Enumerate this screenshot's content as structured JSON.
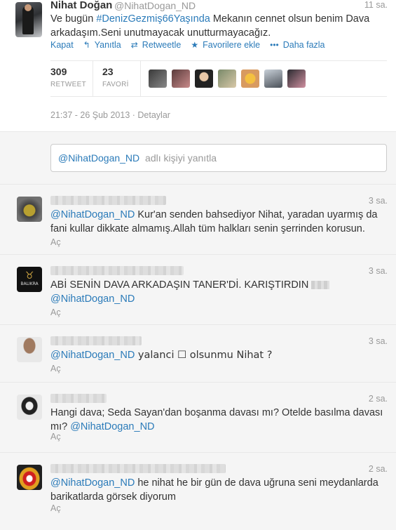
{
  "main_tweet": {
    "name": "Nihat Doğan",
    "handle": "@NihatDogan_ND",
    "time": "11 sa.",
    "text_1": "Ve bugün ",
    "hashtag": "#DenizGezmiş66Yaşında",
    "text_2": " Mekanın cennet olsun benim Dava arkadaşım.Seni unutmayacak unutturmayacağız.",
    "actions": [
      {
        "label": "Kapat",
        "icon": "none"
      },
      {
        "label": "Yanıtla",
        "icon": "reply-arrow-icon"
      },
      {
        "label": "Retweetle",
        "icon": "retweet-icon"
      },
      {
        "label": "Favorilere ekle",
        "icon": "star-icon"
      },
      {
        "label": "Daha fazla",
        "icon": "more-dots-icon"
      }
    ],
    "stats": {
      "retweet_count": "309",
      "retweet_label": "RETWEET",
      "favorite_count": "23",
      "favorite_label": "FAVORİ"
    },
    "timestamp": "21:37 - 26 Şub 2013",
    "separator": " · ",
    "details": "Detaylar"
  },
  "reply_box": {
    "mention": "@NihatDogan_ND",
    "placeholder": "adlı kişiyi yanıtla"
  },
  "replies": [
    {
      "time": "3 sa.",
      "mention": "@NihatDogan_ND",
      "text": " Kur'an senden bahsediyor Nihat, yaradan uyarmış da fani kullar dikkate almamış.Allah tüm halkları senin şerrinden korusun.",
      "reply_label": "Aç"
    },
    {
      "time": "3 sa.",
      "text": "ABİ SENİN DAVA ARKADAŞIN TANER'Dİ. KARIŞTIRDIN ",
      "mention": "@NihatDogan_ND",
      "reply_label": "Aç",
      "avatar_label": "BALIKRA"
    },
    {
      "time": "3 sa.",
      "mention": "@NihatDogan_ND",
      "text": " yalanci ☐ olsunmu Nihat ?",
      "reply_label": "Aç"
    },
    {
      "time": "2 sa.",
      "text": "Hangi dava; Seda Sayan'dan boşanma davası mı? Otelde basılma davası mı? ",
      "mention": "@NihatDogan_ND",
      "reply_label": "Aç"
    },
    {
      "time": "2 sa.",
      "mention": "@NihatDogan_ND",
      "text": " he nihat he bir gün de dava uğruna seni meydanlarda barikatlarda görsek diyorum",
      "reply_label": "Aç"
    }
  ],
  "colors": {
    "link": "#2b7bb9",
    "muted": "#999999",
    "reply_bg": "#f5f5f5"
  }
}
